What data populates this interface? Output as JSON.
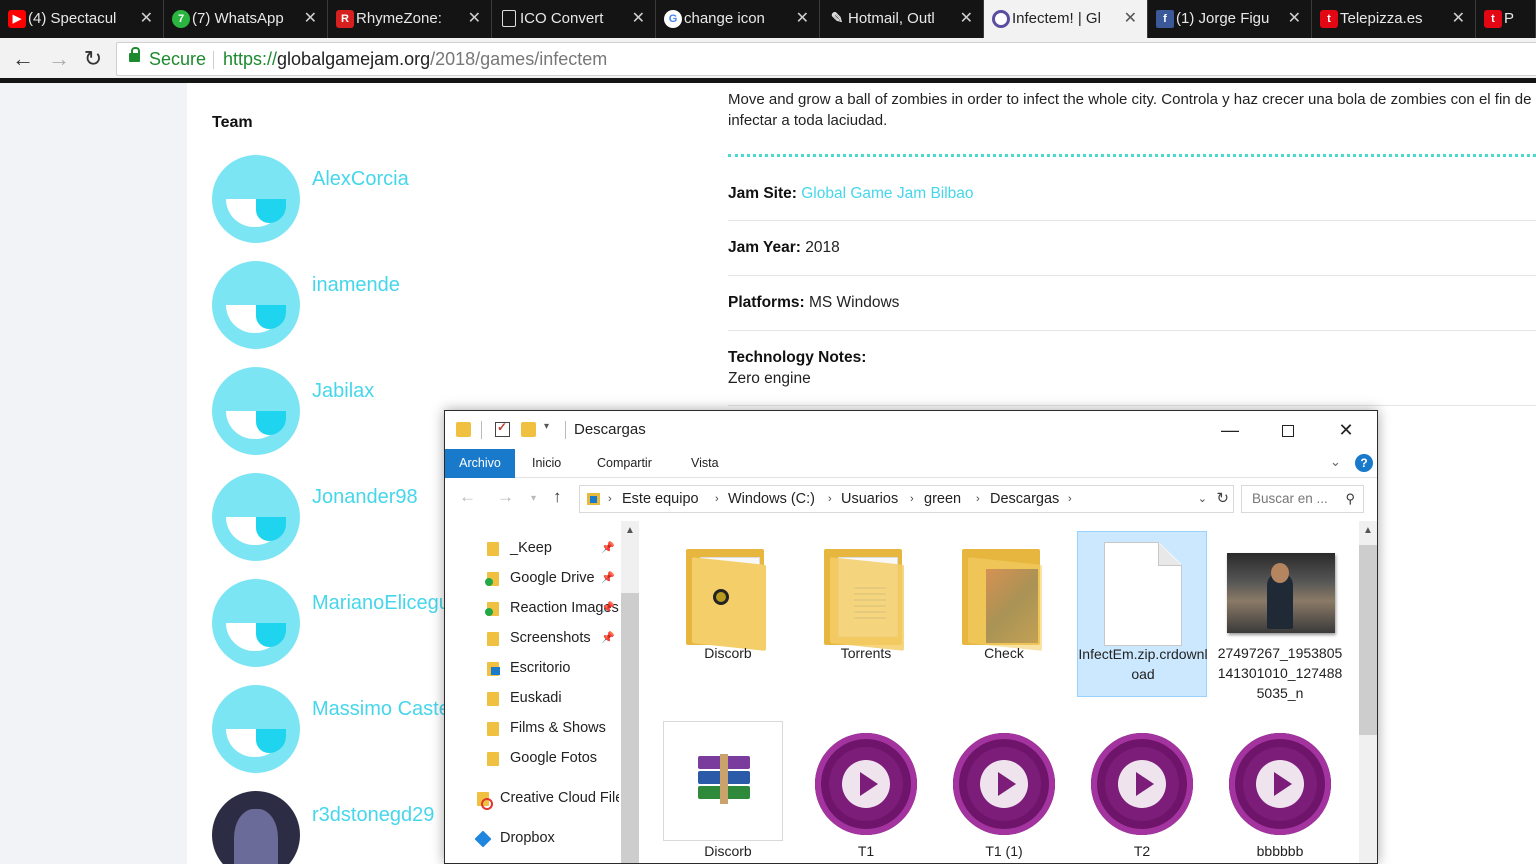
{
  "browser": {
    "tabs": [
      {
        "title": "(4) Spectacul",
        "icon": "youtube-icon"
      },
      {
        "title": "(7) WhatsApp",
        "icon": "whatsapp-icon"
      },
      {
        "title": "RhymeZone:",
        "icon": "rhymezone-icon"
      },
      {
        "title": "ICO Convert",
        "icon": "document-icon"
      },
      {
        "title": "change icon",
        "icon": "google-icon"
      },
      {
        "title": "Hotmail, Outl",
        "icon": "hotmail-icon"
      },
      {
        "title": "Infectem! | Gl",
        "icon": "globalgamejam-icon"
      },
      {
        "title": "(1) Jorge Figu",
        "icon": "facebook-icon"
      },
      {
        "title": "Telepizza.es",
        "icon": "telepizza-icon"
      },
      {
        "title": "P",
        "icon": "telepizza-icon"
      }
    ],
    "address": {
      "secure_label": "Secure",
      "scheme": "https://",
      "host": "globalgamejam.org",
      "path": "/2018/games/infectem"
    }
  },
  "page": {
    "team_heading": "Team",
    "members": [
      "AlexCorcia",
      "inamende",
      "Jabilax",
      "Jonander98",
      "MarianoElicegui",
      "Massimo Castellani",
      "r3dstonegd29"
    ],
    "description": "Move and grow a ball of zombies in order to infect the whole city. Controla y haz crecer una bola de zombies con el fin de infectar a toda laciudad.",
    "jam_site_label": "Jam Site:",
    "jam_site_value": "Global Game Jam Bilbao",
    "jam_year_label": "Jam Year:",
    "jam_year_value": "2018",
    "platforms_label": "Platforms:",
    "platforms_value": "MS Windows",
    "tech_notes_label": "Technology Notes:",
    "tech_notes_value": "Zero engine"
  },
  "explorer": {
    "title": "Descargas",
    "ribbon_tabs": [
      "Archivo",
      "Inicio",
      "Compartir",
      "Vista"
    ],
    "breadcrumb": [
      "Este equipo",
      "Windows (C:)",
      "Usuarios",
      "green",
      "Descargas"
    ],
    "search_placeholder": "Buscar en ...",
    "nav_items": [
      {
        "label": "_Keep",
        "pinned": true
      },
      {
        "label": "Google Drive",
        "pinned": true
      },
      {
        "label": "Reaction Images",
        "pinned": true
      },
      {
        "label": "Screenshots",
        "pinned": true
      },
      {
        "label": "Escritorio",
        "pinned": false
      },
      {
        "label": "Euskadi",
        "pinned": false
      },
      {
        "label": "Films & Shows",
        "pinned": false
      },
      {
        "label": "Google Fotos",
        "pinned": false
      },
      {
        "label": "Creative Cloud Files",
        "pinned": false
      },
      {
        "label": "Dropbox",
        "pinned": false
      }
    ],
    "files": [
      {
        "name": "Discorb",
        "kind": "folder"
      },
      {
        "name": "Torrents",
        "kind": "folder"
      },
      {
        "name": "Check",
        "kind": "folder"
      },
      {
        "name": "InfectEm.zip.crdownload",
        "kind": "file",
        "selected": true
      },
      {
        "name": "27497267_1953805141301010_1274885035_n",
        "kind": "image"
      },
      {
        "name": "Discorb",
        "kind": "archive"
      },
      {
        "name": "T1",
        "kind": "media"
      },
      {
        "name": "T1 (1)",
        "kind": "media"
      },
      {
        "name": "T2",
        "kind": "media"
      },
      {
        "name": "bbbbbb",
        "kind": "media"
      }
    ],
    "colors": {
      "accent": "#1979ca",
      "selection": "#cce8ff"
    }
  },
  "colors": {
    "brand_cyan": "#46d6eb",
    "avatar_bg": "#7ce5f4",
    "secure_green": "#1c8a2e"
  }
}
